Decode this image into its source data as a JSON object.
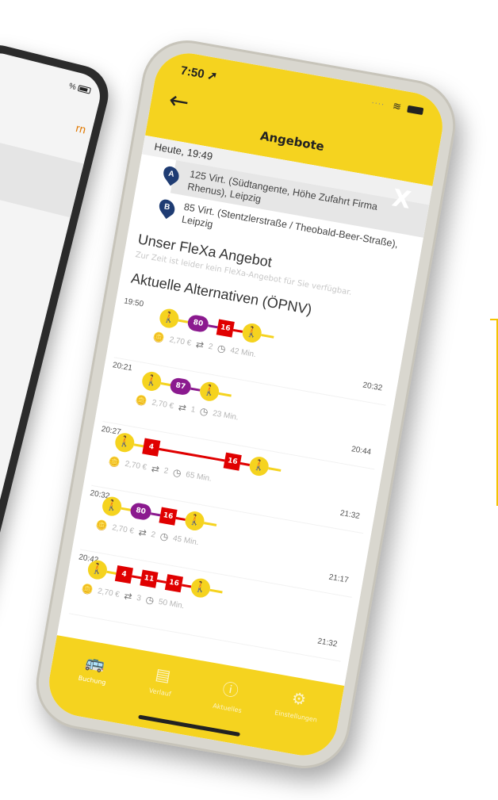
{
  "background_phone": {
    "status_percent": "%",
    "orange_text": "rn"
  },
  "status_bar": {
    "time": "7:50",
    "location_icon": "location-arrow-icon",
    "wifi_icon": "wifi-icon",
    "battery_icon": "battery-icon"
  },
  "header": {
    "back_icon": "arrow-left-icon",
    "back_label": "←",
    "title": "Angebote",
    "logo_icon": "flexa-logo-icon",
    "logo_label": "X"
  },
  "trip": {
    "date": "Heute, 19:49",
    "origin": {
      "pin": "A",
      "text": "125 Virt. (Südtangente, Höhe Zufahrt Firma Rhenus), Leipzig"
    },
    "destination": {
      "pin": "B",
      "text": "85 Virt. (Stentzlerstraße / Theobald-Beer-Straße), Leipzig"
    }
  },
  "flexa": {
    "title": "Unser FleXa Angebot",
    "message": "Zur Zeit ist leider kein FleXa-Angebot für Sie verfügbar."
  },
  "alternatives": {
    "title": "Aktuelle Alternativen (ÖPNV)",
    "routes": [
      {
        "departure": "19:50",
        "arrival": "20:32",
        "price": "2,70 €",
        "transfers": "2",
        "duration": "42 Min.",
        "legs": [
          "walk",
          "80",
          "16",
          "walk"
        ]
      },
      {
        "departure": "20:21",
        "arrival": "20:44",
        "price": "2,70 €",
        "transfers": "1",
        "duration": "23 Min.",
        "legs": [
          "walk",
          "87",
          "walk"
        ]
      },
      {
        "departure": "20:27",
        "arrival": "21:32",
        "price": "2,70 €",
        "transfers": "2",
        "duration": "65 Min.",
        "legs": [
          "walk",
          "4",
          "16",
          "walk"
        ]
      },
      {
        "departure": "20:32",
        "arrival": "21:17",
        "price": "2,70 €",
        "transfers": "2",
        "duration": "45 Min.",
        "legs": [
          "walk",
          "80",
          "16",
          "walk"
        ]
      },
      {
        "departure": "20:42",
        "arrival": "21:32",
        "price": "2,70 €",
        "transfers": "3",
        "duration": "50 Min.",
        "legs": [
          "walk",
          "4",
          "11",
          "16",
          "walk"
        ]
      }
    ]
  },
  "tabbar": {
    "tabs": [
      {
        "label": "Buchung",
        "icon": "bus-icon",
        "glyph": "🚌"
      },
      {
        "label": "Verlauf",
        "icon": "history-icon",
        "glyph": "▤"
      },
      {
        "label": "Aktuelles",
        "icon": "info-icon",
        "glyph": "ⓘ"
      },
      {
        "label": "Einstellungen",
        "icon": "gear-icon",
        "glyph": "⚙"
      }
    ]
  },
  "colors": {
    "brand_yellow": "#f5d31f",
    "bus_purple": "#8b1a8f",
    "tram_red": "#e00000",
    "pin_blue": "#1f3c73"
  }
}
